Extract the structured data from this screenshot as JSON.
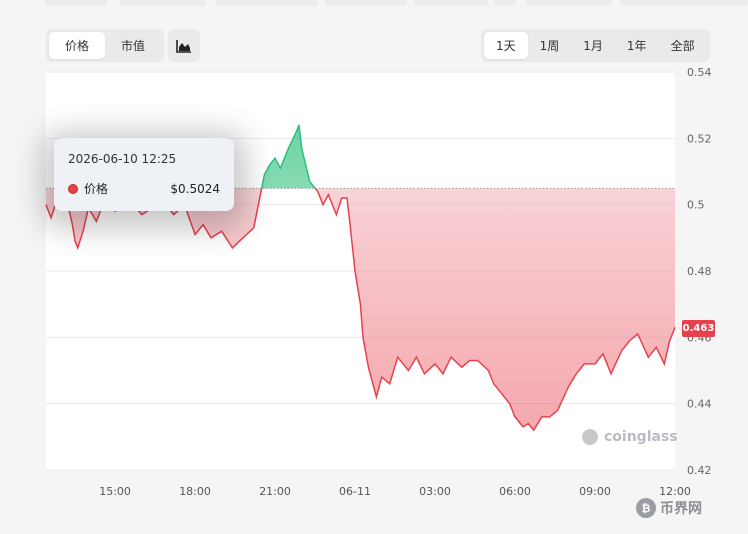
{
  "controls": {
    "metric_options": [
      "价格",
      "市值"
    ],
    "metric_selected": 0,
    "range_options": [
      "1天",
      "1周",
      "1月",
      "1年",
      "全部"
    ],
    "range_selected": 0
  },
  "tooltip": {
    "date": "2026-06-10 12:25",
    "series_label": "价格",
    "value": "$0.5024"
  },
  "current_price_label": "0.463",
  "watermark": "coinglass",
  "site_logo": "币界网",
  "colors": {
    "down": "#e8414d",
    "up": "#2bbf7b",
    "down_fill": "#f6c9cf",
    "up_fill": "#bfeed8"
  },
  "chart_data": {
    "type": "area",
    "baseline": 0.5049,
    "y_ticks": [
      0.42,
      0.44,
      0.46,
      0.48,
      0.5,
      0.52,
      0.54
    ],
    "ylim": [
      0.42,
      0.54
    ],
    "x_ticks": [
      "15:00",
      "18:00",
      "21:00",
      "06-11",
      "03:00",
      "06:00",
      "09:00",
      "12:00"
    ],
    "x_range_hours": [
      12.41,
      24.0
    ],
    "grid": true,
    "series": [
      {
        "x": [
          12.41,
          12.6,
          12.8,
          13.0,
          13.2,
          13.4,
          13.5,
          13.6,
          13.8,
          14.0,
          14.3,
          14.6,
          15.0,
          15.3,
          15.6,
          16.0,
          16.4,
          16.8,
          17.2,
          17.6,
          18.0,
          18.3,
          18.6,
          19.0,
          19.4,
          19.8,
          20.2,
          20.5,
          20.6,
          20.8,
          21.0,
          21.2,
          21.5,
          21.8,
          21.9,
          22.0,
          22.3,
          22.6,
          22.8,
          23.0,
          23.3,
          23.5,
          23.7,
          23.8,
          24.0,
          24.2,
          24.3,
          24.5,
          24.8,
          25.0,
          25.3,
          25.6,
          26.0,
          26.3,
          26.6,
          27.0,
          27.3,
          27.6,
          28.0,
          28.3,
          28.6,
          29.0,
          29.2,
          29.5,
          29.8,
          30.0,
          30.3,
          30.5,
          30.7,
          31.0,
          31.3,
          31.6,
          32.0,
          32.3,
          32.6,
          33.0,
          33.3,
          33.6,
          34.0,
          34.3,
          34.6,
          35.0,
          35.3,
          35.6,
          35.8,
          36.0
        ],
        "y": [
          0.5,
          0.496,
          0.501,
          0.499,
          0.501,
          0.494,
          0.489,
          0.487,
          0.492,
          0.499,
          0.495,
          0.501,
          0.498,
          0.5,
          0.501,
          0.497,
          0.499,
          0.501,
          0.497,
          0.5,
          0.491,
          0.494,
          0.49,
          0.492,
          0.487,
          0.49,
          0.493,
          0.505,
          0.509,
          0.512,
          0.514,
          0.511,
          0.517,
          0.522,
          0.524,
          0.517,
          0.507,
          0.504,
          0.5,
          0.503,
          0.497,
          0.502,
          0.502,
          0.495,
          0.48,
          0.47,
          0.46,
          0.451,
          0.442,
          0.448,
          0.446,
          0.454,
          0.45,
          0.454,
          0.449,
          0.452,
          0.449,
          0.454,
          0.451,
          0.453,
          0.453,
          0.45,
          0.446,
          0.443,
          0.44,
          0.436,
          0.433,
          0.434,
          0.432,
          0.436,
          0.436,
          0.438,
          0.445,
          0.449,
          0.452,
          0.452,
          0.455,
          0.449,
          0.456,
          0.459,
          0.461,
          0.454,
          0.457,
          0.452,
          0.459,
          0.463
        ]
      }
    ]
  }
}
